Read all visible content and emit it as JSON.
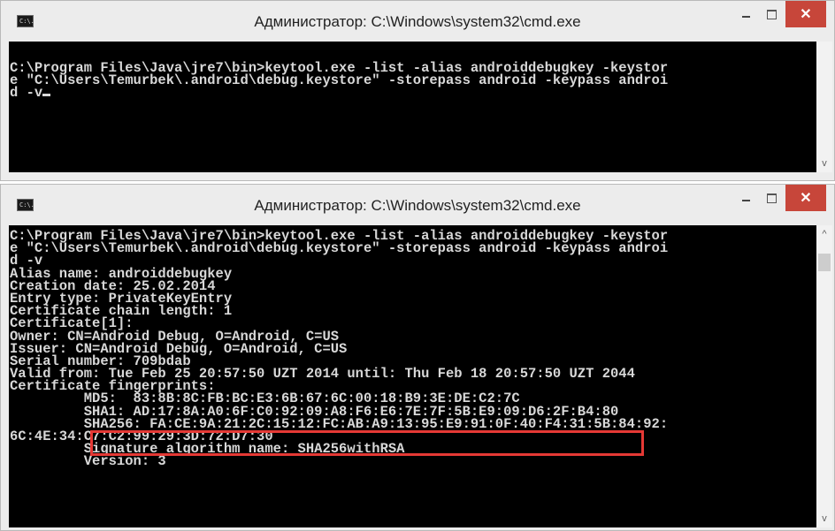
{
  "window_top": {
    "title": "Администратор: C:\\Windows\\system32\\cmd.exe",
    "icon_text": "C:\\.",
    "lines": [
      "C:\\Program Files\\Java\\jre7\\bin>keytool.exe -list -alias androiddebugkey -keystor",
      "e \"C:\\Users\\Temurbek\\.android\\debug.keystore\" -storepass android -keypass androi",
      "d -v"
    ]
  },
  "window_bottom": {
    "title": "Администратор: C:\\Windows\\system32\\cmd.exe",
    "icon_text": "C:\\.",
    "lines": [
      "C:\\Program Files\\Java\\jre7\\bin>keytool.exe -list -alias androiddebugkey -keystor",
      "e \"C:\\Users\\Temurbek\\.android\\debug.keystore\" -storepass android -keypass androi",
      "d -v",
      "Alias name: androiddebugkey",
      "Creation date: 25.02.2014",
      "Entry type: PrivateKeyEntry",
      "Certificate chain length: 1",
      "Certificate[1]:",
      "Owner: CN=Android Debug, O=Android, C=US",
      "Issuer: CN=Android Debug, O=Android, C=US",
      "Serial number: 709bdab",
      "Valid from: Tue Feb 25 20:57:50 UZT 2014 until: Thu Feb 18 20:57:50 UZT 2044",
      "Certificate fingerprints:",
      "         MD5:  83:8B:8C:FB:BC:E3:6B:67:6C:00:18:B9:3E:DE:C2:7C",
      "         SHA1: AD:17:8A:A0:6F:C0:92:09:A8:F6:E6:7E:7F:5B:E9:09:D6:2F:B4:80",
      "         SHA256: FA:CE:9A:21:2C:15:12:FC:AB:A9:13:95:E9:91:0F:40:F4:31:5B:84:92:",
      "6C:4E:34:C7:C2:99:29:3D:72:D7:30",
      "         Signature algorithm name: SHA256withRSA",
      "         Version: 3"
    ]
  },
  "controls": {
    "minimize": "–",
    "maximize": "□",
    "close": "✕"
  },
  "scrollbar": {
    "up": "^",
    "down": "v"
  },
  "colors": {
    "console_bg": "#000000",
    "console_fg": "#d8d8d8",
    "close_bg": "#c7463a",
    "highlight": "#e53935"
  }
}
